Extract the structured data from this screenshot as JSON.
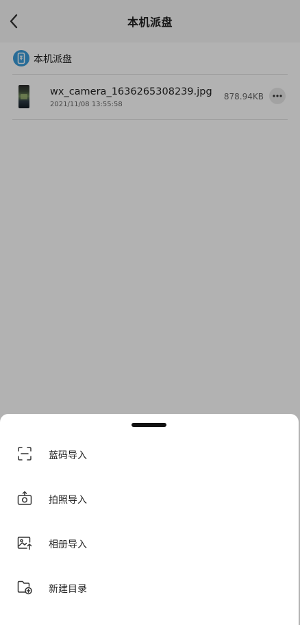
{
  "header": {
    "back_icon": "chevron-left-icon",
    "title": "本机派盘"
  },
  "breadcrumb": {
    "icon": "phone-drive-icon",
    "label": "本机派盘",
    "accent": "#3a9bd9"
  },
  "files": [
    {
      "name": "wx_camera_1636265308239.jpg",
      "date": "2021/11/08 13:55:58",
      "size": "878.94KB",
      "more_icon": "more-dots-icon"
    }
  ],
  "sheet": {
    "items": [
      {
        "label": "蓝码导入",
        "icon": "scan-icon"
      },
      {
        "label": "拍照导入",
        "icon": "camera-upload-icon"
      },
      {
        "label": "相册导入",
        "icon": "album-upload-icon"
      },
      {
        "label": "新建目录",
        "icon": "new-folder-icon"
      }
    ]
  }
}
